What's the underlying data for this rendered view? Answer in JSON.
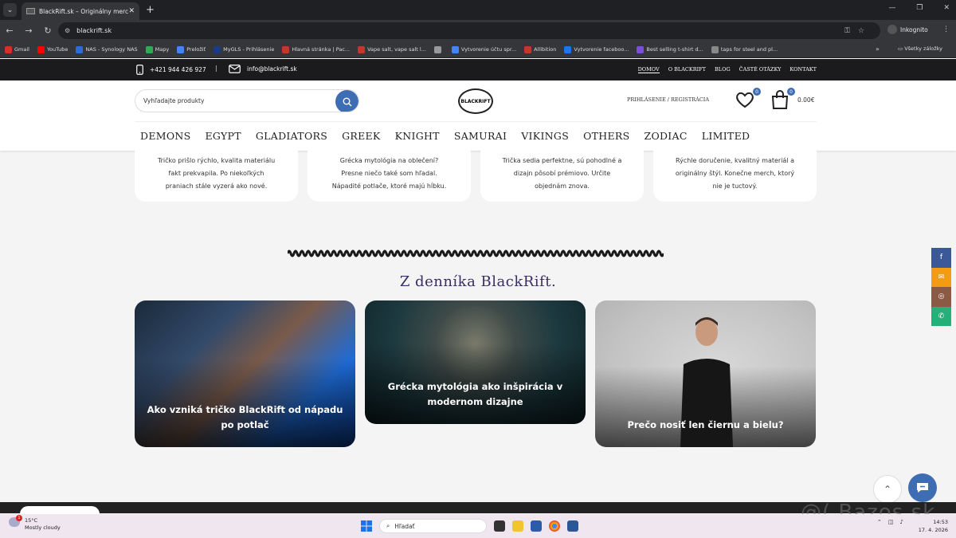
{
  "browser": {
    "tab_title": "BlackRift.sk – Originálny merch",
    "url": "blackrift.sk",
    "profile": "Inkognito",
    "bookmarks": [
      {
        "label": "Gmail",
        "color": "#d93025"
      },
      {
        "label": "YouTube",
        "color": "#ff0000"
      },
      {
        "label": "NAS - Synology NAS",
        "color": "#2a6dd8"
      },
      {
        "label": "Mapy",
        "color": "#34a853"
      },
      {
        "label": "Preložiť",
        "color": "#4285f4"
      },
      {
        "label": "MyGLS - Prihlásenie",
        "color": "#1a3a8a"
      },
      {
        "label": "Hlavná stránka | Pac...",
        "color": "#c0392b"
      },
      {
        "label": "Vape salt, vape salt l...",
        "color": "#c0392b"
      },
      {
        "label": "",
        "color": "#999"
      },
      {
        "label": "Vytvorenie účtu spr...",
        "color": "#4285f4"
      },
      {
        "label": "Allibition",
        "color": "#c0392b"
      },
      {
        "label": "Vytvorenie faceboo...",
        "color": "#1877f2"
      },
      {
        "label": "Best selling t-shirt d...",
        "color": "#7b4fd6"
      },
      {
        "label": "taps for steel and pl...",
        "color": "#888"
      }
    ],
    "all_bookmarks": "Všetky záložky"
  },
  "topbar": {
    "phone": "+421 944 426 927",
    "separator": "|",
    "email": "info@blackrift.sk",
    "links": [
      "DOMOV",
      "O BLACKRIFT",
      "BLOG",
      "ČASTÉ OTÁZKY",
      "KONTAKT"
    ]
  },
  "header": {
    "search_placeholder": "Vyhľadajte produkty",
    "logo_text": "BLACKRIFT",
    "login": "PRIHLÁSENIE / REGISTRÁCIA",
    "wishlist_count": "0",
    "cart_count": "0",
    "cart_total": "0.00€"
  },
  "categories": [
    "DEMONS",
    "EGYPT",
    "GLADIATORS",
    "GREEK",
    "KNIGHT",
    "SAMURAI",
    "VIKINGS",
    "OTHERS",
    "ZODIAC",
    "LIMITED"
  ],
  "reviews": [
    {
      "l1": "Tričko prišlo rýchlo, kvalita materiálu",
      "l2": "fakt prekvapila. Po niekoľkých",
      "l3": "praniach stále vyzerá ako nové."
    },
    {
      "l1": "Grécka mytológia na oblečení?",
      "l2": "Presne niečo také som hľadal.",
      "l3": "Nápadité potlače, ktoré majú hĺbku."
    },
    {
      "l1": "Trička sedia perfektne, sú pohodlné a",
      "l2": "dizajn pôsobí prémiovo. Určite",
      "l3": "objednám znova."
    },
    {
      "l1": "Rýchle doručenie, kvalitný materiál a",
      "l2": "originálny štýl. Konečne merch, ktorý",
      "l3": "nie je tuctový."
    }
  ],
  "blog": {
    "title": "Z denníka BlackRift.",
    "posts": [
      {
        "title": "Ako vzniká tričko BlackRift od nápadu po potlač"
      },
      {
        "title": "Grécka mytológia ako inšpirácia v modernom dizajne"
      },
      {
        "title": "Prečo nosiť len čiernu a bielu?"
      }
    ]
  },
  "social": [
    {
      "icon": "f",
      "color": "#3b5998"
    },
    {
      "icon": "✉",
      "color": "#f39c12"
    },
    {
      "icon": "◎",
      "color": "#8a5a44"
    },
    {
      "icon": "✆",
      "color": "#25b07a"
    }
  ],
  "watermark": "@( Bazos.sk",
  "taskbar": {
    "temp": "15°C",
    "weather": "Mostly cloudy",
    "search": "Hľadať",
    "time": "14:53",
    "date": "17. 4. 2026",
    "weather_badge": "1"
  }
}
